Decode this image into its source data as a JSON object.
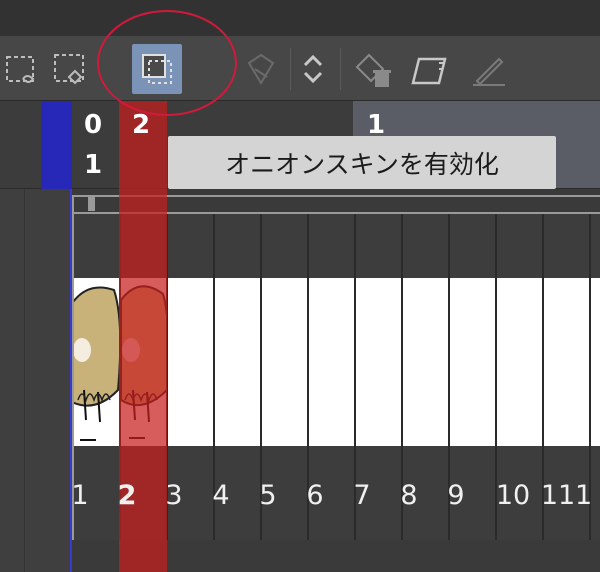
{
  "toolbar": {
    "buttons": [
      {
        "name": "new-cel-icon",
        "active": false
      },
      {
        "name": "specify-cel-icon",
        "active": false
      },
      {
        "name": "onion-skin-icon",
        "active": true
      },
      {
        "name": "lightbox-icon",
        "active": false
      },
      {
        "name": "move-cel-icon",
        "active": false
      },
      {
        "name": "delete-cel-icon",
        "active": false
      },
      {
        "name": "cel-shape-icon",
        "active": false
      },
      {
        "name": "pen-icon",
        "active": false
      }
    ]
  },
  "ruler": {
    "top_left": "0",
    "top_current": "2",
    "top_right": "1",
    "bottom_left": "1"
  },
  "tooltip": {
    "text": "オニオンスキンを有効化"
  },
  "timeline": {
    "frames": [
      "1",
      "2",
      "3",
      "4",
      "5",
      "6",
      "7",
      "8",
      "9",
      "10",
      "11",
      "1"
    ],
    "current_frame": "2"
  },
  "colors": {
    "toolbar_bg": "#474747",
    "active_button": "#7a93b6",
    "annotation": "#d11a3b",
    "current_frame_column": "#c81e1e",
    "playhead": "#2727b8",
    "cel_drawing": "#c9b27a"
  }
}
